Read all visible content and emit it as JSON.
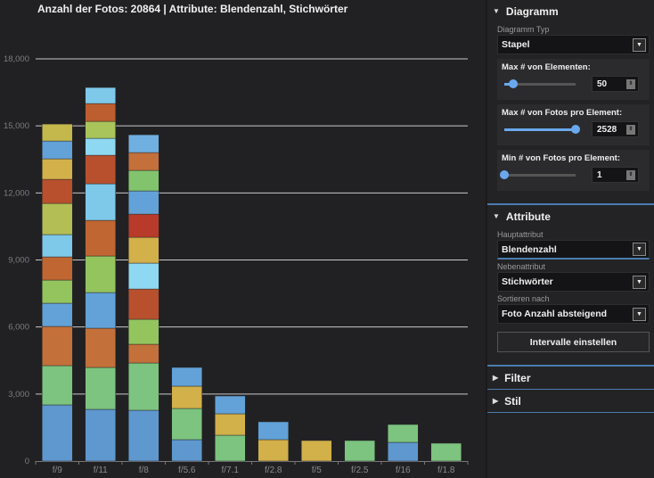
{
  "title": "Anzahl der Fotos: 20864 | Attribute: Blendenzahl, Stichwörter",
  "chart_data": {
    "type": "bar",
    "stacked": true,
    "categories": [
      "f/9",
      "f/11",
      "f/8",
      "f/5.6",
      "f/7.1",
      "f/2.8",
      "f/5",
      "f/2.5",
      "f/16",
      "f/1.8"
    ],
    "ylim": [
      0,
      18000
    ],
    "yticks": [
      "0",
      "3,000",
      "6,000",
      "9,000",
      "12,000",
      "15,000",
      "18,000"
    ],
    "ytick_values": [
      0,
      3000,
      6000,
      9000,
      12000,
      15000,
      18000
    ],
    "grid": true,
    "stacks": [
      [
        {
          "v": 2514,
          "c": "#5e98cf"
        },
        {
          "v": 1756,
          "c": "#7cc47f"
        },
        {
          "v": 1755,
          "c": "#c4703a"
        },
        {
          "v": 1038,
          "c": "#62a2d8"
        },
        {
          "v": 1037,
          "c": "#94c45e"
        },
        {
          "v": 1037,
          "c": "#c06632"
        },
        {
          "v": 998,
          "c": "#7ec8ea"
        },
        {
          "v": 1396,
          "c": "#b3be55"
        },
        {
          "v": 1077,
          "c": "#b8502e"
        },
        {
          "v": 918,
          "c": "#d2b04a"
        },
        {
          "v": 798,
          "c": "#62a2d8"
        },
        {
          "v": 758,
          "c": "#c4b84c"
        }
      ],
      [
        {
          "v": 2314,
          "c": "#5e98cf"
        },
        {
          "v": 1876,
          "c": "#7cc47f"
        },
        {
          "v": 1755,
          "c": "#c4703a"
        },
        {
          "v": 1596,
          "c": "#62a2d8"
        },
        {
          "v": 1636,
          "c": "#94c45e"
        },
        {
          "v": 1596,
          "c": "#c06632"
        },
        {
          "v": 1636,
          "c": "#7ec8ea"
        },
        {
          "v": 1277,
          "c": "#b8502e"
        },
        {
          "v": 758,
          "c": "#8fd8f2"
        },
        {
          "v": 758,
          "c": "#a8c45a"
        },
        {
          "v": 798,
          "c": "#bc5e30"
        },
        {
          "v": 718,
          "c": "#7ec8ea"
        }
      ],
      [
        {
          "v": 2274,
          "c": "#5e98cf"
        },
        {
          "v": 2115,
          "c": "#7cc47f"
        },
        {
          "v": 838,
          "c": "#c4703a"
        },
        {
          "v": 1117,
          "c": "#94c45e"
        },
        {
          "v": 1356,
          "c": "#b8502e"
        },
        {
          "v": 1158,
          "c": "#8fd8f2"
        },
        {
          "v": 1157,
          "c": "#d2b04a"
        },
        {
          "v": 1037,
          "c": "#b83a2a"
        },
        {
          "v": 1038,
          "c": "#62a2d8"
        },
        {
          "v": 918,
          "c": "#82c46e"
        },
        {
          "v": 797,
          "c": "#c4703a"
        },
        {
          "v": 798,
          "c": "#6fb0e0"
        }
      ],
      [
        {
          "v": 958,
          "c": "#5e98cf"
        },
        {
          "v": 1396,
          "c": "#7cc47f"
        },
        {
          "v": 998,
          "c": "#d2b04a"
        },
        {
          "v": 838,
          "c": "#62a2d8"
        }
      ],
      [
        {
          "v": 1157,
          "c": "#7cc47f"
        },
        {
          "v": 958,
          "c": "#d2b04a"
        },
        {
          "v": 798,
          "c": "#62a2d8"
        }
      ],
      [
        {
          "v": 958,
          "c": "#d2b04a"
        },
        {
          "v": 798,
          "c": "#62a2d8"
        }
      ],
      [
        {
          "v": 918,
          "c": "#d2b04a"
        }
      ],
      [
        {
          "v": 918,
          "c": "#7cc47f"
        }
      ],
      [
        {
          "v": 838,
          "c": "#5e98cf"
        },
        {
          "v": 798,
          "c": "#7cc47f"
        }
      ],
      [
        {
          "v": 798,
          "c": "#7cc47f"
        }
      ]
    ]
  },
  "panel": {
    "diagramm": {
      "header": "Diagramm",
      "type_label": "Diagramm Typ",
      "type_value": "Stapel",
      "max_elements": {
        "label": "Max # von Elementen:",
        "value": "50",
        "fraction": 0.12
      },
      "max_photos": {
        "label": "Max # von Fotos pro Element:",
        "value": "2528",
        "fraction": 1.0
      },
      "min_photos": {
        "label": "Min # von Fotos pro Element:",
        "value": "1",
        "fraction": 0.0
      }
    },
    "attribute": {
      "header": "Attribute",
      "main_label": "Hauptattribut",
      "main_value": "Blendenzahl",
      "sub_label": "Nebenattribut",
      "sub_value": "Stichwörter",
      "sort_label": "Sortieren nach",
      "sort_value": "Foto Anzahl absteigend",
      "interval_button": "Intervalle einstellen"
    },
    "filter": {
      "header": "Filter"
    },
    "stil": {
      "header": "Stil"
    }
  }
}
